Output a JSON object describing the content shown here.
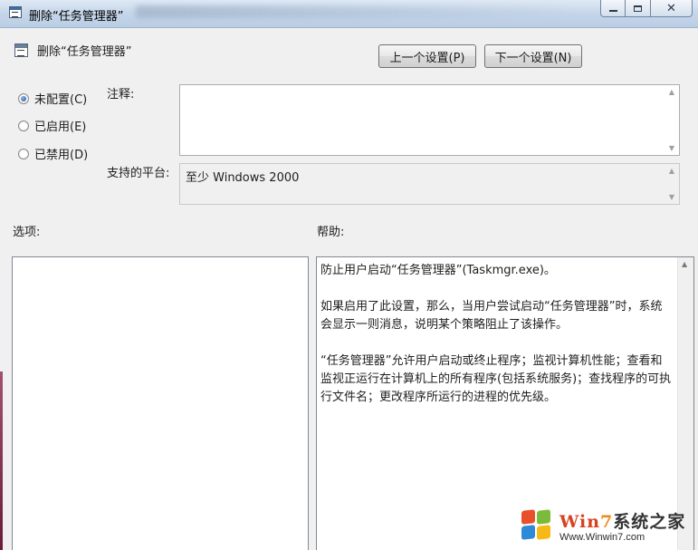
{
  "window": {
    "title": "删除“任务管理器”",
    "minimize_icon": "minimize-icon",
    "maximize_icon": "maximize-icon",
    "close_icon": "close-icon"
  },
  "header": {
    "setting_icon": "policy-setting-icon",
    "title": "删除“任务管理器”",
    "prev_button": "上一个设置(P)",
    "next_button": "下一个设置(N)"
  },
  "state": {
    "options": [
      {
        "label": "未配置(C)",
        "checked": true
      },
      {
        "label": "已启用(E)",
        "checked": false
      },
      {
        "label": "已禁用(D)",
        "checked": false
      }
    ]
  },
  "comment": {
    "label": "注释:",
    "value": ""
  },
  "platform": {
    "label": "支持的平台:",
    "value": "至少 Windows 2000"
  },
  "options_pane": {
    "label": "选项:"
  },
  "help_pane": {
    "label": "帮助:",
    "paragraphs": [
      "防止用户启动“任务管理器”(Taskmgr.exe)。",
      "如果启用了此设置，那么，当用户尝试启动“任务管理器”时，系统会显示一则消息，说明某个策略阻止了该操作。",
      "“任务管理器”允许用户启动或终止程序；监视计算机性能；查看和监视正运行在计算机上的所有程序(包括系统服务)；查找程序的可执行文件名；更改程序所运行的进程的优先级。"
    ]
  },
  "watermark": {
    "brand_a": "Win",
    "brand_b": "7",
    "brand_c": "系统之家",
    "url": "Www.Winwin7.com"
  },
  "colors": {
    "titlebar": "#c7d7ea",
    "dialog_bg": "#f0f0f0",
    "radio_selected": "#1e4f9e"
  }
}
